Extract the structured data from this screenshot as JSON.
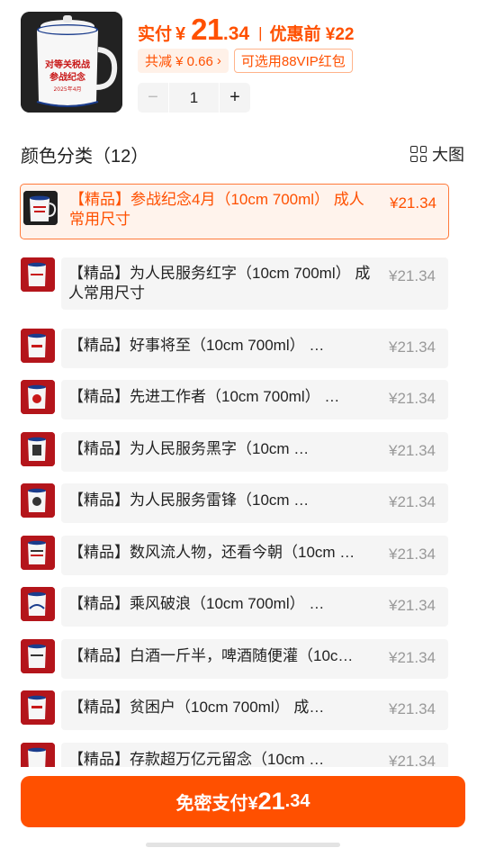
{
  "header": {
    "product_image_alt": "enamel mug",
    "mug_text_line1": "对等关税战",
    "mug_text_line2": "参战纪念",
    "mug_text_line3": "2025年4月",
    "price_label": "实付",
    "currency": "¥",
    "price_int": "21",
    "price_dec": ".34",
    "separator": "|",
    "original_label": "优惠前 ¥22",
    "discount_tag": "共减 ¥ 0.66",
    "discount_chevron": "›",
    "vip_tag": "可选用88VIP红包",
    "quantity": "1",
    "minus": "−",
    "plus": "+"
  },
  "section": {
    "title": "颜色分类（12）",
    "view_label": "大图",
    "view_icon": "grid-icon"
  },
  "items": [
    {
      "label": "【精品】参战纪念4月（10cm 700ml） 成人常用尺寸",
      "price": "¥21.34",
      "selected": true
    },
    {
      "label": "【精品】为人民服务红字（10cm 700ml） 成人常用尺寸",
      "price": "¥21.34"
    },
    {
      "label": "【精品】好事将至（10cm 700ml） …",
      "price": "¥21.34"
    },
    {
      "label": "【精品】先进工作者（10cm 700ml） …",
      "price": "¥21.34"
    },
    {
      "label": "【精品】为人民服务黑字（10cm …",
      "price": "¥21.34"
    },
    {
      "label": "【精品】为人民服务雷锋（10cm …",
      "price": "¥21.34"
    },
    {
      "label": "【精品】数风流人物，还看今朝（10cm …",
      "price": "¥21.34"
    },
    {
      "label": "【精品】乘风破浪（10cm 700ml） …",
      "price": "¥21.34"
    },
    {
      "label": "【精品】白酒一斤半，啤酒随便灌（10c…",
      "price": "¥21.34"
    },
    {
      "label": "【精品】贫困户（10cm 700ml） 成…",
      "price": "¥21.34"
    },
    {
      "label": "【精品】存款超万亿元留念（10cm …",
      "price": "¥21.34"
    }
  ],
  "footer": {
    "pay_label": "免密支付¥",
    "pay_int": "21",
    "pay_dec": ".34"
  },
  "colors": {
    "accent": "#ff5000",
    "selected_bg": "#fff3ec",
    "row_bg": "#f5f5f5",
    "muted_text": "#999999"
  }
}
